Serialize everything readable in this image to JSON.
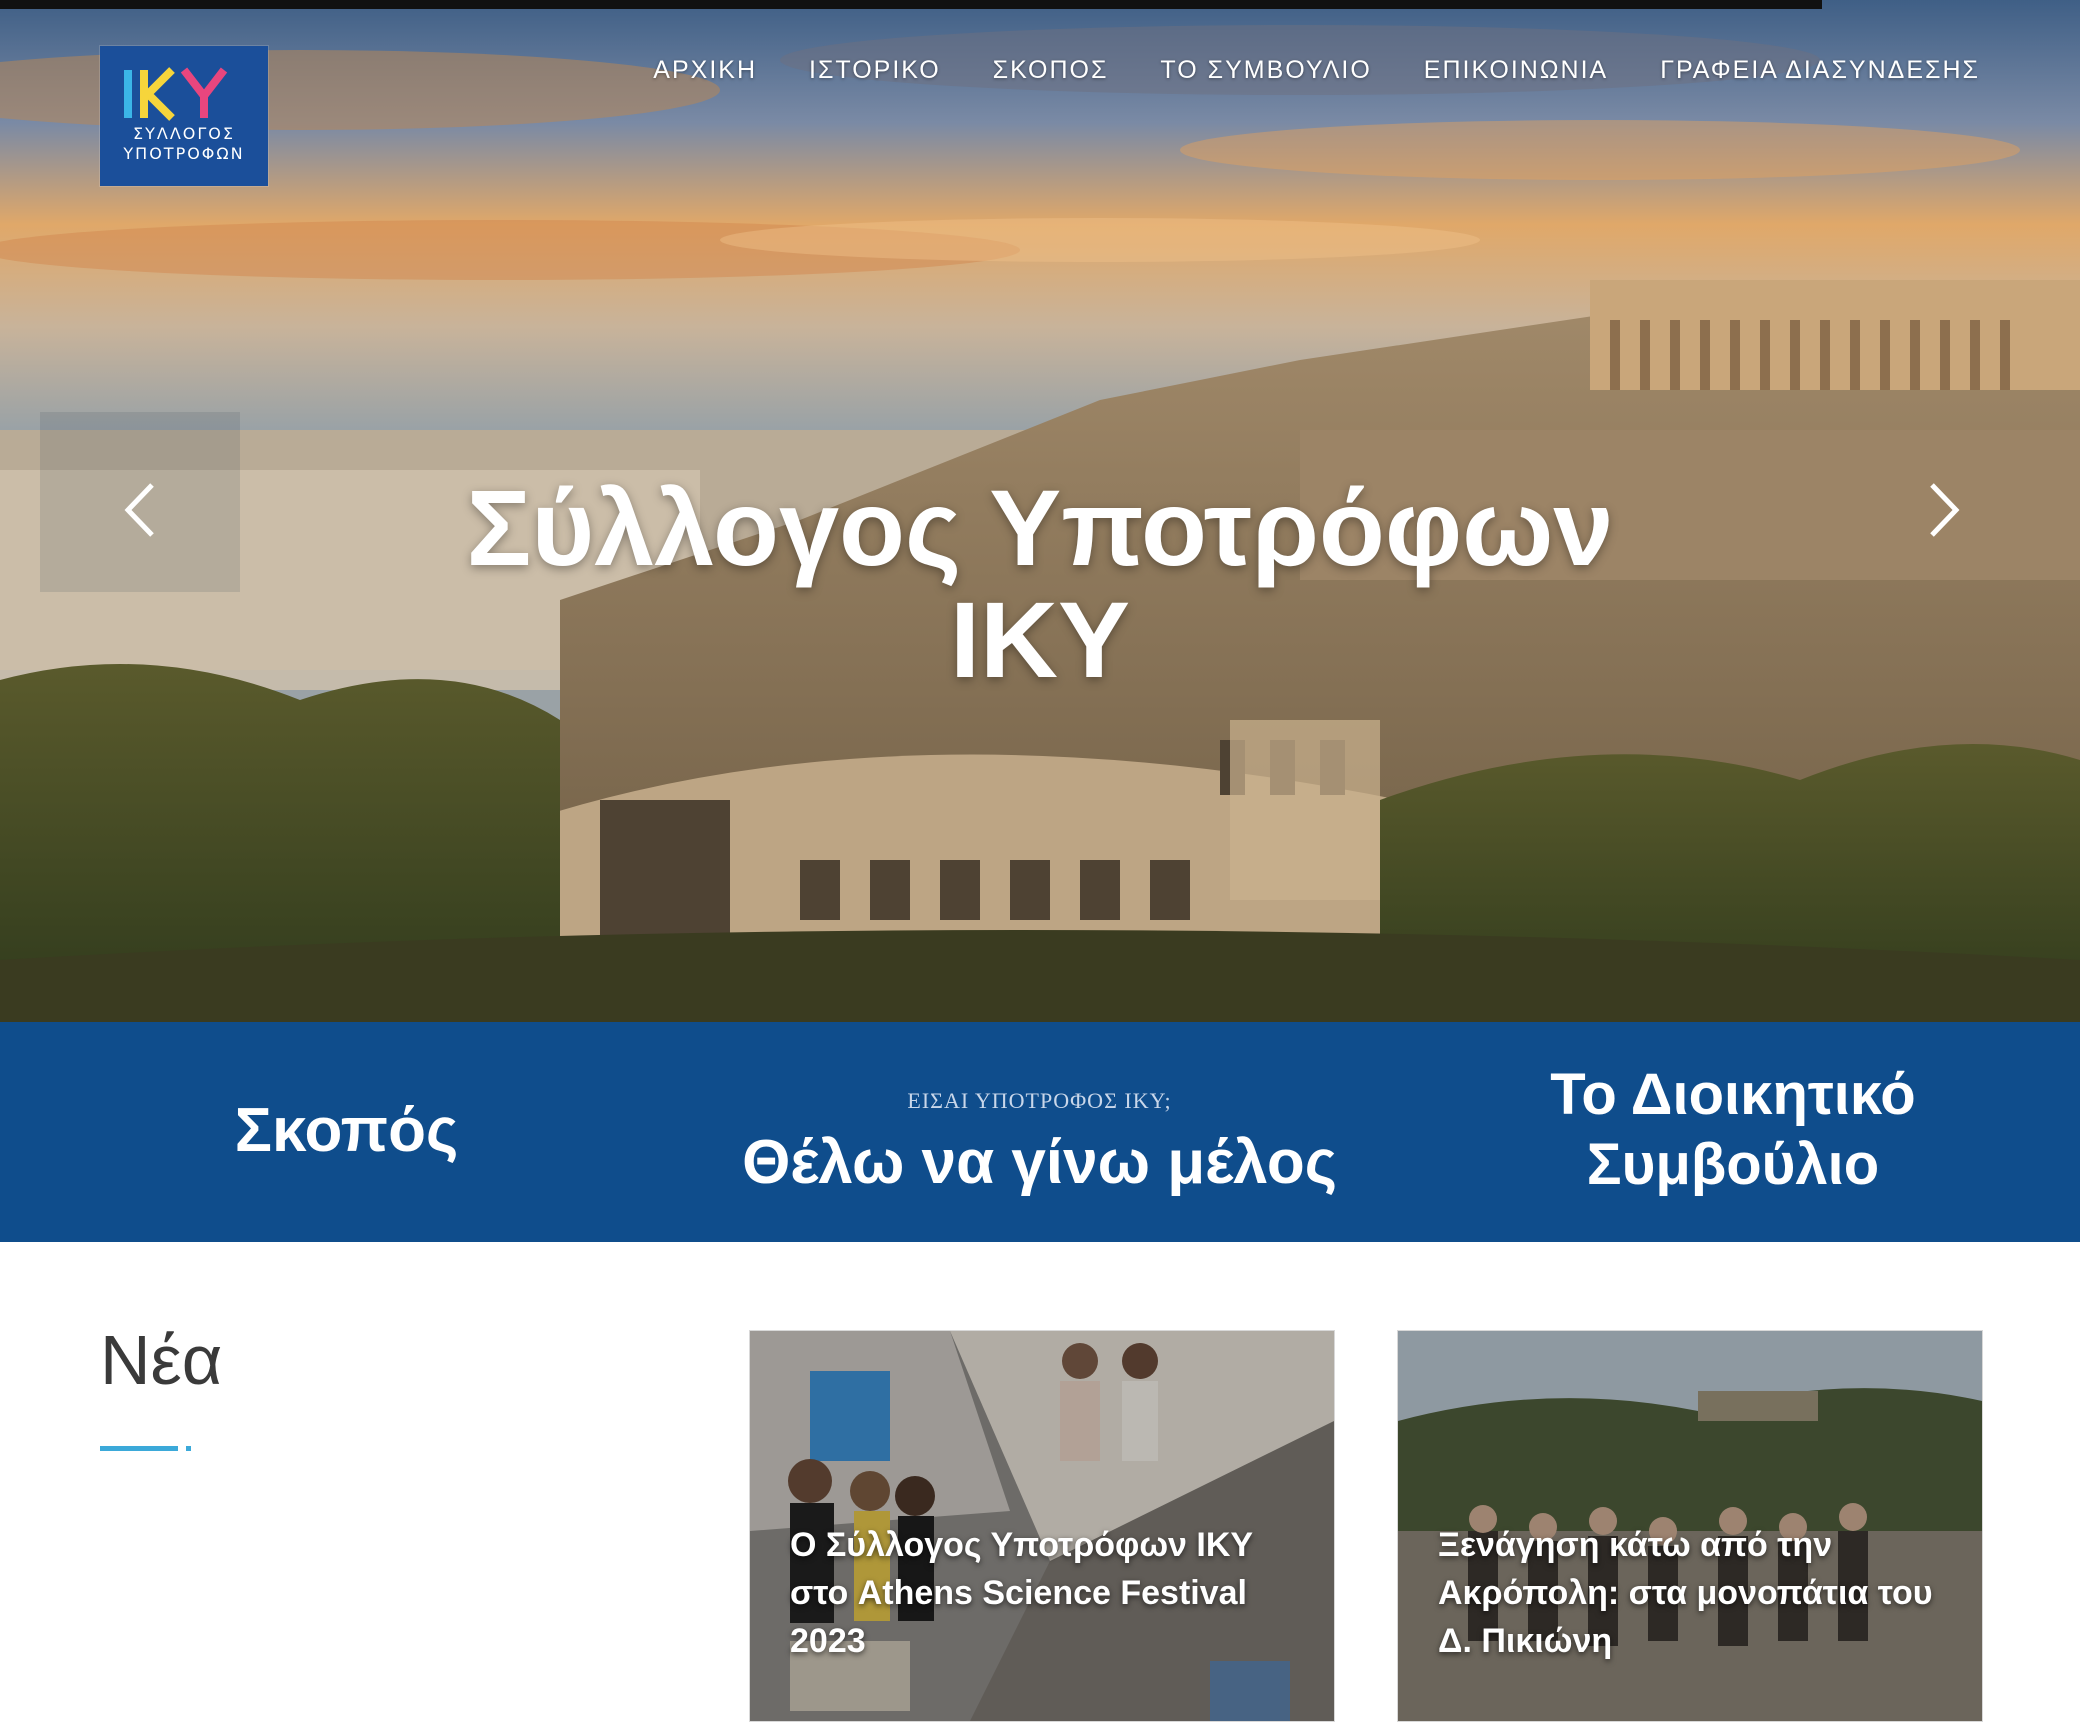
{
  "brand": {
    "logo_letters": "IKY",
    "logo_line1": "ΣΥΛΛΟΓΟΣ",
    "logo_line2": "ΥΠΟΤΡΟΦΩΝ"
  },
  "nav": {
    "items": [
      {
        "label": "ΑΡΧΙΚΗ"
      },
      {
        "label": "ΙΣΤΟΡΙΚΟ"
      },
      {
        "label": "ΣΚΟΠΟΣ"
      },
      {
        "label": "ΤΟ ΣΥΜΒΟΥΛΙΟ"
      },
      {
        "label": "ΕΠΙΚΟΙΝΩΝΙΑ"
      },
      {
        "label": "ΓΡΑΦΕΙΑ ΔΙΑΣΥΝΔΕΣΗΣ"
      }
    ]
  },
  "hero": {
    "title_line1": "Σύλλογος Υποτρόφων",
    "title_line2": "ΙΚΥ"
  },
  "band": {
    "purpose": "Σκοπός",
    "member_kicker": "ΕΙΣΑΙ ΥΠΟΤΡΟΦΟΣ ΙΚΥ;",
    "member_cta": "Θέλω να γίνω μέλος",
    "board_line1": "Το Διοικητικό",
    "board_line2": "Συμβούλιο"
  },
  "news": {
    "heading": "Νέα",
    "cards": [
      {
        "title": "Ο Σύλλογος Υποτρόφων ΙΚΥ στο Athens Science Festival 2023"
      },
      {
        "title": "Ξενάγηση κάτω από την Ακρόπολη: στα μονοπάτια του Δ. Πικιώνη"
      }
    ]
  },
  "colors": {
    "band_blue": "#0f4d8c",
    "logo_blue": "#1b4f9a",
    "accent_cyan": "#3ba9d9"
  }
}
